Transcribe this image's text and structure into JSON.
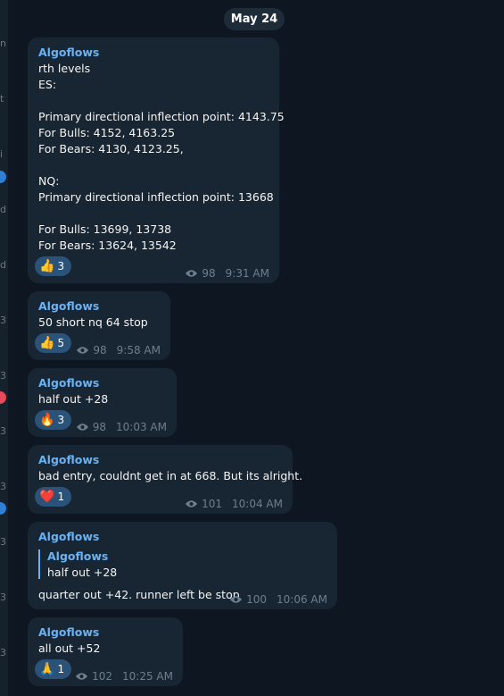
{
  "date_divider": "May 24",
  "left_strip": {
    "chars": [
      "n",
      "t",
      "i",
      "d",
      "d",
      "3",
      "3",
      "3",
      "3",
      "3",
      "3",
      "3",
      "3"
    ],
    "dot_colors": {
      "blue": "#2f7fd6",
      "red": "#e54b5a"
    }
  },
  "messages": [
    {
      "sender": "Algoflows",
      "lines": [
        "rth  levels",
        "ES:",
        "",
        "Primary directional inflection point: 4143.75",
        "For Bulls: 4152, 4163.25",
        "For Bears: 4130, 4123.25,",
        "",
        "NQ:",
        "Primary directional inflection point: 13668",
        "",
        "For Bulls: 13699, 13738",
        "For Bears:  13624, 13542"
      ],
      "reaction": {
        "emoji": "👍",
        "count": "3"
      },
      "views": "98",
      "time": "9:31 AM"
    },
    {
      "sender": "Algoflows",
      "lines": [
        "50 short nq 64 stop"
      ],
      "reaction": {
        "emoji": "👍",
        "count": "5"
      },
      "views": "98",
      "time": "9:58 AM"
    },
    {
      "sender": "Algoflows",
      "lines": [
        "half out +28"
      ],
      "reaction": {
        "emoji": "🔥",
        "count": "3"
      },
      "views": "98",
      "time": "10:03 AM"
    },
    {
      "sender": "Algoflows",
      "lines": [
        "bad entry, couldnt get in at 668. But its alright."
      ],
      "reaction": {
        "emoji": "❤️",
        "count": "1"
      },
      "views": "101",
      "time": "10:04 AM"
    },
    {
      "sender": "Algoflows",
      "reply_to": {
        "name": "Algoflows",
        "text": "half out +28"
      },
      "lines": [
        "quarter out +42. runner left be stop"
      ],
      "views": "100",
      "time": "10:06 AM"
    },
    {
      "sender": "Algoflows",
      "lines": [
        "all out +52"
      ],
      "reaction": {
        "emoji": "🙏",
        "count": "1"
      },
      "views": "102",
      "time": "10:25 AM"
    }
  ],
  "colors": {
    "background": "#0e1621",
    "bubble": "#182533",
    "sender": "#6ab2f2",
    "reaction_pill": "#2b5278",
    "meta": "#6d7f8f"
  }
}
